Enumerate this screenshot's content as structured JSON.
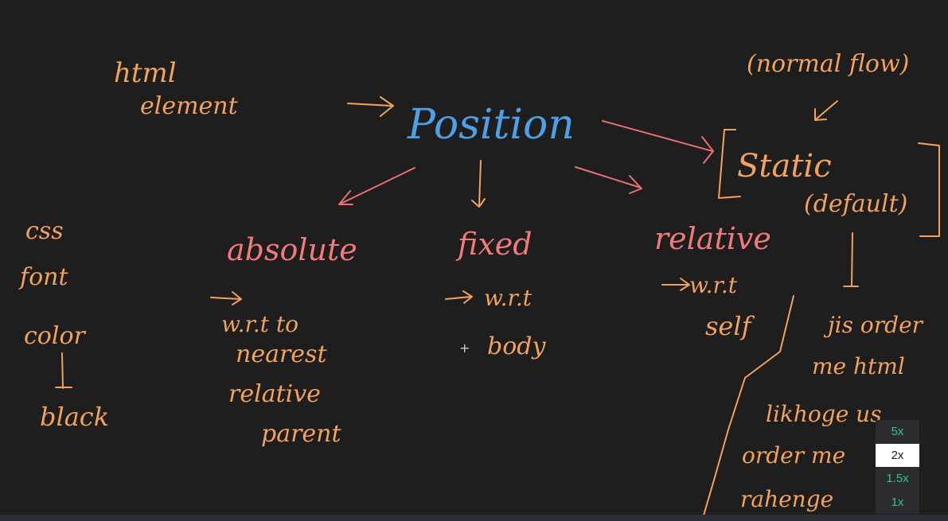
{
  "board": {
    "html_element_1": "html",
    "html_element_2": "element",
    "position": "Position",
    "normal_flow": "(normal flow)",
    "static": "Static",
    "default": "(default)",
    "absolute": "absolute",
    "fixed": "fixed",
    "relative": "relative",
    "abs_wrt": "w.r.t  to",
    "abs_nearest": "nearest",
    "abs_relative": "relative",
    "abs_parent": "parent",
    "fixed_wrt": "w.r.t",
    "fixed_body": "body",
    "rel_wrt": "w.r.t",
    "rel_self": "self",
    "css": "css",
    "font": "font",
    "color": "color",
    "black": "black",
    "jis_order": "jis order",
    "me_html": "me html",
    "likhoge": "likhoge us",
    "order_me": "order me",
    "rahenge": "rahenge"
  },
  "speed_menu": {
    "options": [
      "5x",
      "2x",
      "1.5x",
      "1x"
    ],
    "selected": "2x"
  },
  "colors": {
    "background": "#1e1e1e",
    "orange": "#f2a25c",
    "pink": "#f27a7a",
    "blue": "#4f9fe6",
    "speed_green": "#33c28f"
  }
}
